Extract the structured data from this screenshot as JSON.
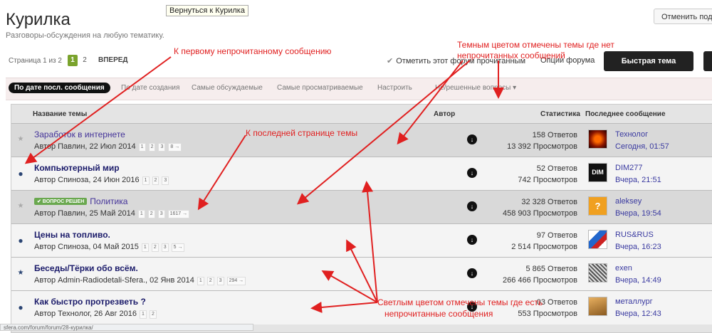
{
  "page": {
    "title": "Курилка",
    "subtitle": "Разговоры-обсуждения на любую тематику."
  },
  "tooltip": "Вернуться к  Курилка",
  "header": {
    "unfollow_label": "Отменить подп"
  },
  "pager": {
    "label": "Страница 1 из 2",
    "current": "1",
    "page2": "2",
    "next": "ВПЕРЕД"
  },
  "toolbar": {
    "mark_read": "Отметить этот форум прочитанным",
    "forum_options": "Опции форума",
    "quick_topic": "Быстрая тема"
  },
  "filters": [
    "По дате посл. сообщения",
    "По дате создания",
    "Самые обсуждаемые",
    "Самые просматриваемые",
    "Настроить",
    "Не/решенные вопросы"
  ],
  "columns": {
    "topic": "Название темы",
    "author": "Автор",
    "stats": "Статистика",
    "last": "Последнее сообщение"
  },
  "rows": [
    {
      "title": "Заработок в интернете",
      "badge": "",
      "meta": "Автор Павлин, 22 Июл 2014",
      "pages": [
        "1",
        "2",
        "3",
        "8 →"
      ],
      "replies": "158 Ответов",
      "views": "13 392 Просмотров",
      "last_user": "Технолог",
      "last_time": "Сегодня, 01:57"
    },
    {
      "title": "Компьютерный мир",
      "badge": "",
      "meta": "Автор Спиноза, 24 Июн 2016",
      "pages": [
        "1",
        "2",
        "3"
      ],
      "replies": "52 Ответов",
      "views": "742 Просмотров",
      "last_user": "DIM277",
      "last_time": "Вчера, 21:51"
    },
    {
      "title": "Политика",
      "badge": "✔ ВОПРОС РЕШЕН",
      "meta": "Автор Павлин, 25 Май 2014",
      "pages": [
        "1",
        "2",
        "3",
        "1617 →"
      ],
      "replies": "32 328 Ответов",
      "views": "458 903 Просмотров",
      "last_user": "aleksey",
      "last_time": "Вчера, 19:54"
    },
    {
      "title": "Цены на топливо.",
      "badge": "",
      "meta": "Автор Спиноза, 04 Май 2015",
      "pages": [
        "1",
        "2",
        "3",
        "5 →"
      ],
      "replies": "97 Ответов",
      "views": "2 514 Просмотров",
      "last_user": "RUS&RUS",
      "last_time": "Вчера, 16:23"
    },
    {
      "title": "Беседы/Тёрки обо всём.",
      "badge": "",
      "meta": "Автор Admin-Radiodetali-Sfera., 02 Янв 2014",
      "pages": [
        "1",
        "2",
        "3",
        "294 →"
      ],
      "replies": "5 865 Ответов",
      "views": "266 466 Просмотров",
      "last_user": "exen",
      "last_time": "Вчера, 14:49"
    },
    {
      "title": "Как быстро протрезветь ?",
      "badge": "",
      "meta": "Автор Технолог, 26 Авг 2016",
      "pages": [
        "1",
        "2"
      ],
      "replies": "03 Ответов",
      "views": "553 Просмотров",
      "last_user": "металлург",
      "last_time": "Вчера, 12:43"
    }
  ],
  "annotations": {
    "first_unread": "К первому непрочитанному сообщению",
    "last_page": "К последней странице темы",
    "dark_line1": "Темным цветом отмечены темы где нет",
    "dark_line2": "непрочитанных сообщений",
    "light_line1": "Светлым цветом отмечены темы где есть",
    "light_line2": "непрочитанные сообщения"
  },
  "statusbar": "sfera.com/forum/forum/28-курилка/",
  "colors": {
    "accent_green": "#7aa32d",
    "dark_button": "#222222",
    "link": "#443399",
    "annotation": "#e02020"
  },
  "icons": {
    "download": "download-icon",
    "star": "star-icon",
    "unread_dot": "unread-dot-icon"
  }
}
